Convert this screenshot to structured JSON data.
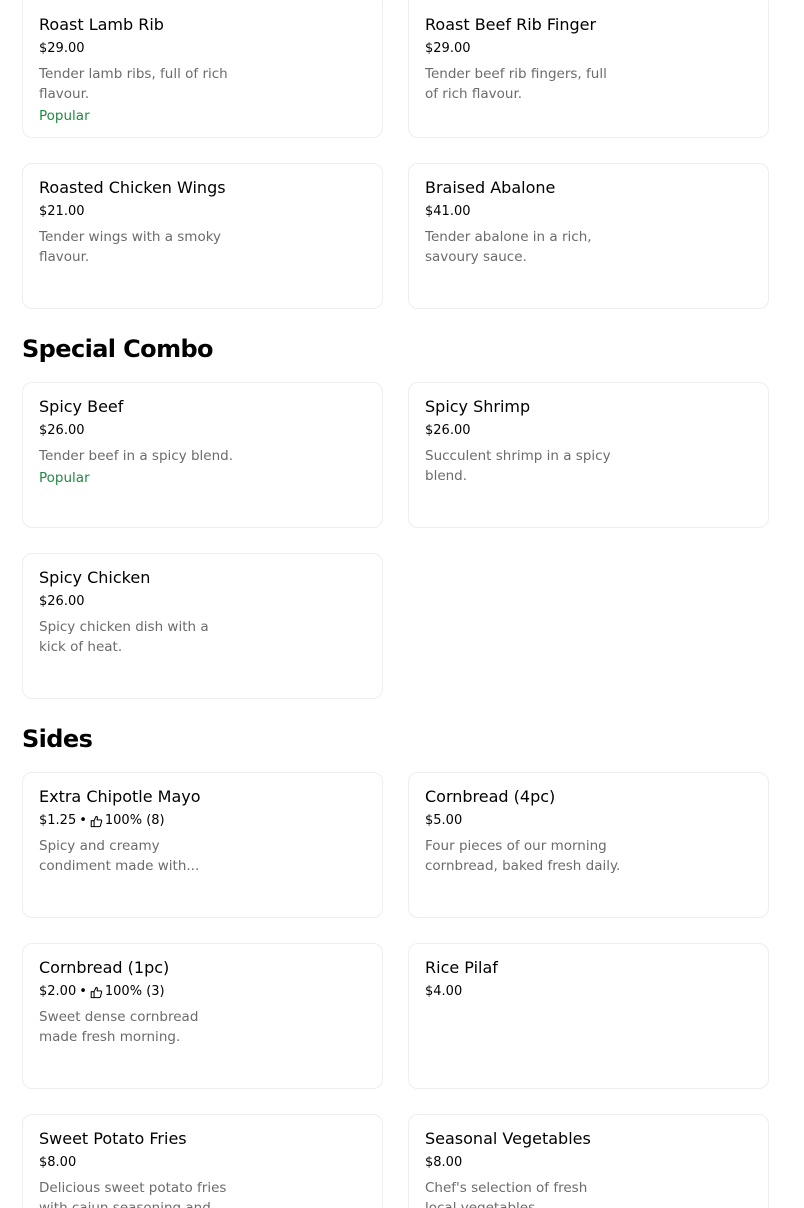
{
  "top_items": [
    {
      "name": "Roast Lamb Rib",
      "price": "$29.00",
      "description": "Tender lamb ribs, full of rich flavour.",
      "badge": "Popular"
    },
    {
      "name": "Roast Beef Rib Finger",
      "price": "$29.00",
      "description": "Tender beef rib fingers, full of rich flavour."
    },
    {
      "name": "Roasted Chicken Wings",
      "price": "$21.00",
      "description": "Tender wings with a smoky flavour."
    },
    {
      "name": "Braised Abalone",
      "price": "$41.00",
      "description": "Tender abalone in a rich, savoury sauce."
    }
  ],
  "special_combo": {
    "title": "Special Combo",
    "items": [
      {
        "name": "Spicy Beef",
        "price": "$26.00",
        "description": "Tender beef in a spicy blend.",
        "badge": "Popular"
      },
      {
        "name": "Spicy Shrimp",
        "price": "$26.00",
        "description": "Succulent shrimp in a spicy blend."
      },
      {
        "name": "Spicy Chicken",
        "price": "$26.00",
        "description": "Spicy chicken dish with a kick of heat."
      }
    ]
  },
  "sides": {
    "title": "Sides",
    "items": [
      {
        "name": "Extra Chipotle Mayo",
        "price": "$1.25",
        "separator": "•",
        "rating": "100% (8)",
        "description": "Spicy and creamy condiment made with..."
      },
      {
        "name": "Cornbread (4pc)",
        "price": "$5.00",
        "description": "Four pieces of our morning cornbread, baked fresh daily."
      },
      {
        "name": "Cornbread (1pc)",
        "price": "$2.00",
        "separator": "•",
        "rating": "100% (3)",
        "description": "Sweet dense cornbread made fresh morning."
      },
      {
        "name": "Rice Pilaf",
        "price": "$4.00"
      },
      {
        "name": "Sweet Potato Fries",
        "price": "$8.00",
        "description": "Delicious sweet potato fries with cajun seasoning and..."
      },
      {
        "name": "Seasonal Vegetables",
        "price": "$8.00",
        "description": "Chef's selection of fresh local vegetables."
      }
    ]
  },
  "colors": {
    "badge": "#1f8a43",
    "description": "#6b6b6b",
    "card_border": "#eeeeee"
  },
  "icons": {
    "rating": "thumbs-up-icon"
  }
}
